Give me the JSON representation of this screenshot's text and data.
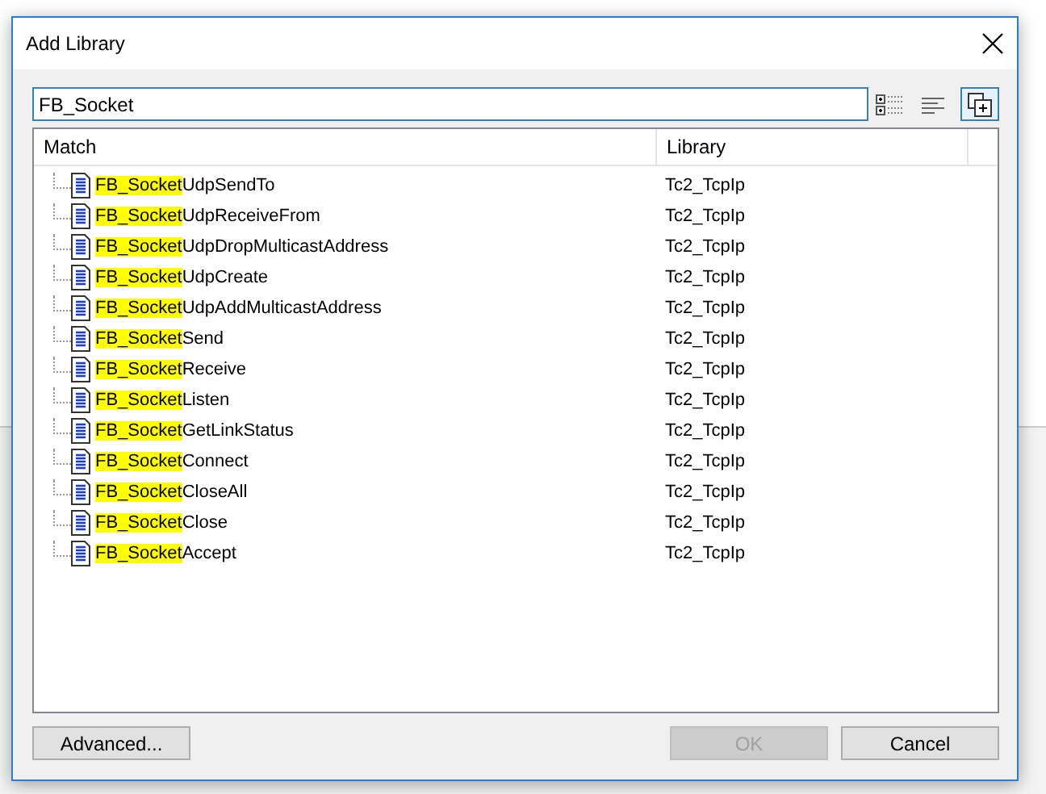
{
  "window": {
    "title": "Add Library"
  },
  "search": {
    "value": "FB_Socket"
  },
  "table": {
    "columns": [
      "Match",
      "Library"
    ],
    "rows": [
      {
        "match": "FB_Socket",
        "rest": "UdpSendTo",
        "library": "Tc2_TcpIp"
      },
      {
        "match": "FB_Socket",
        "rest": "UdpReceiveFrom",
        "library": "Tc2_TcpIp"
      },
      {
        "match": "FB_Socket",
        "rest": "UdpDropMulticastAddress",
        "library": "Tc2_TcpIp"
      },
      {
        "match": "FB_Socket",
        "rest": "UdpCreate",
        "library": "Tc2_TcpIp"
      },
      {
        "match": "FB_Socket",
        "rest": "UdpAddMulticastAddress",
        "library": "Tc2_TcpIp"
      },
      {
        "match": "FB_Socket",
        "rest": "Send",
        "library": "Tc2_TcpIp"
      },
      {
        "match": "FB_Socket",
        "rest": "Receive",
        "library": "Tc2_TcpIp"
      },
      {
        "match": "FB_Socket",
        "rest": "Listen",
        "library": "Tc2_TcpIp"
      },
      {
        "match": "FB_Socket",
        "rest": "GetLinkStatus",
        "library": "Tc2_TcpIp"
      },
      {
        "match": "FB_Socket",
        "rest": "Connect",
        "library": "Tc2_TcpIp"
      },
      {
        "match": "FB_Socket",
        "rest": "CloseAll",
        "library": "Tc2_TcpIp"
      },
      {
        "match": "FB_Socket",
        "rest": "Close",
        "library": "Tc2_TcpIp"
      },
      {
        "match": "FB_Socket",
        "rest": "Accept",
        "library": "Tc2_TcpIp"
      }
    ]
  },
  "buttons": [
    {
      "label": "Advanced...",
      "disabled": false,
      "kind": "left"
    },
    {
      "label": "OK",
      "disabled": true,
      "kind": "right"
    },
    {
      "label": "Cancel",
      "disabled": false,
      "kind": "right"
    }
  ]
}
